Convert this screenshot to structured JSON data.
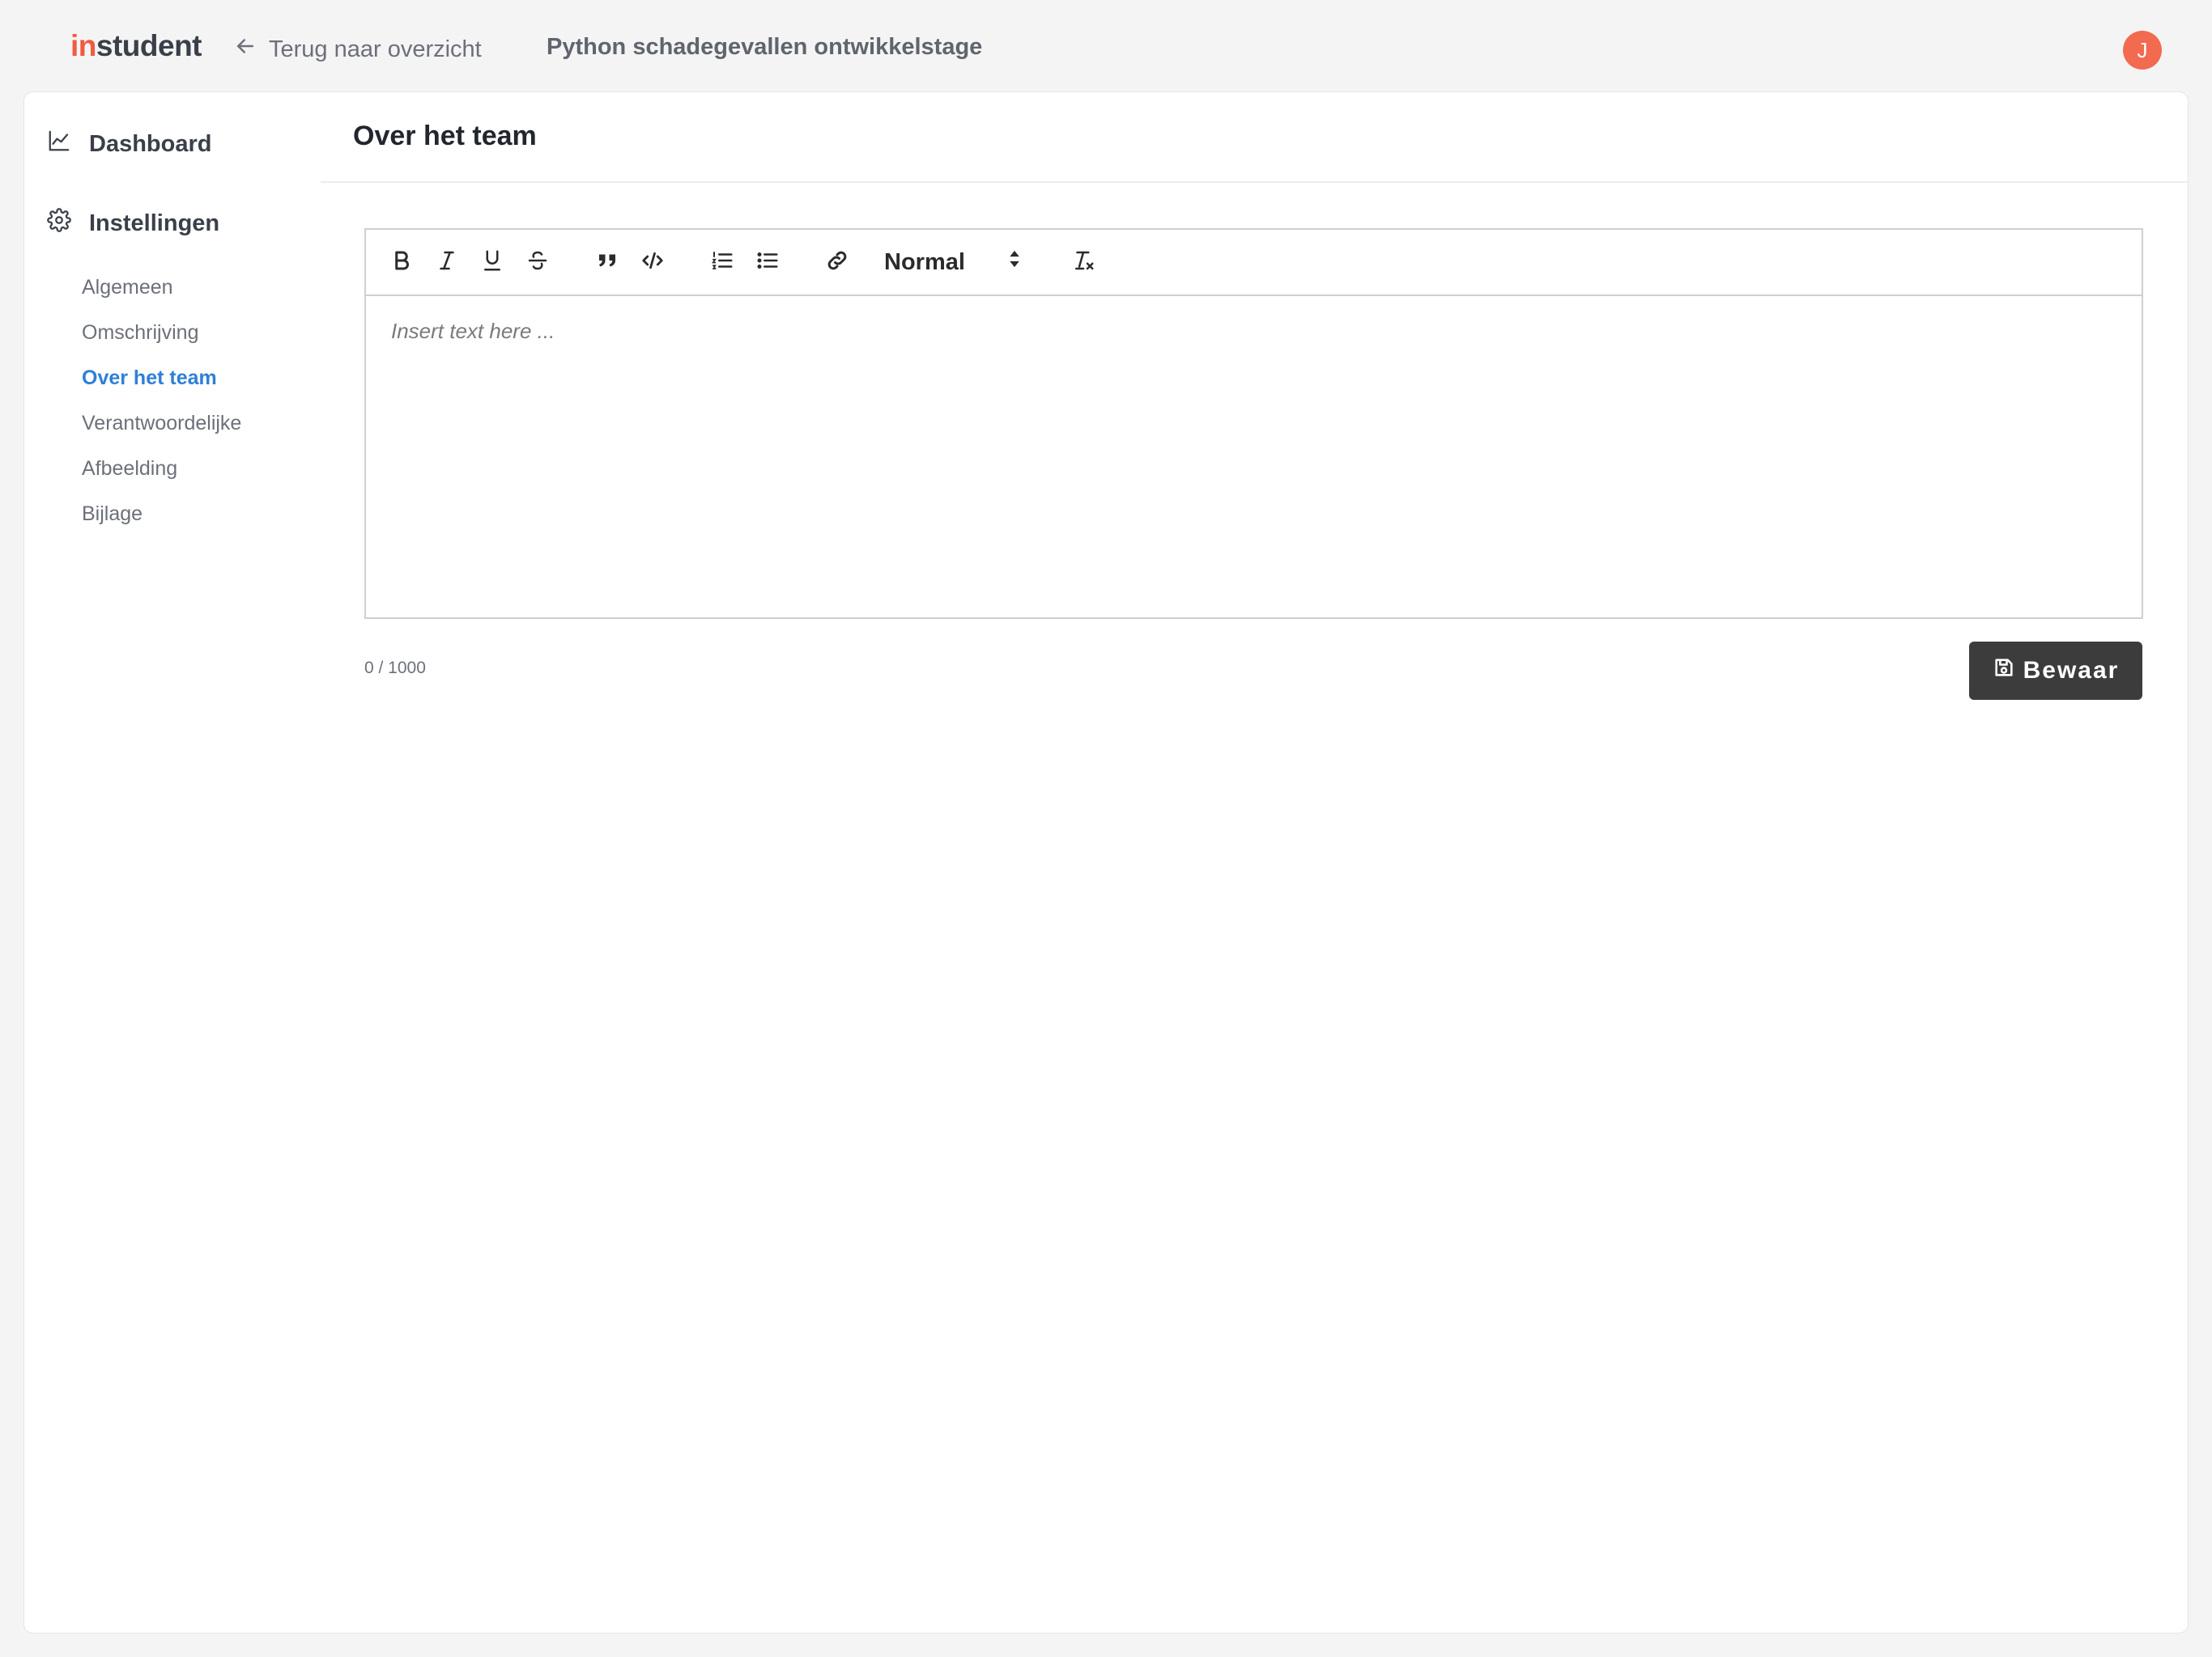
{
  "brand": {
    "prefix": "in",
    "suffix": "student",
    "accent_color": "#f15a40"
  },
  "topbar": {
    "back_label": "Terug naar overzicht",
    "project_title": "Python schadegevallen ontwikkelstage",
    "avatar_initial": "J",
    "avatar_color": "#f26a4f"
  },
  "sidebar": {
    "dashboard_label": "Dashboard",
    "settings_label": "Instellingen",
    "items": [
      {
        "label": "Algemeen",
        "active": false
      },
      {
        "label": "Omschrijving",
        "active": false
      },
      {
        "label": "Over het team",
        "active": true
      },
      {
        "label": "Verantwoordelijke",
        "active": false
      },
      {
        "label": "Afbeelding",
        "active": false
      },
      {
        "label": "Bijlage",
        "active": false
      }
    ],
    "active_color": "#2f7fd8"
  },
  "content": {
    "title": "Over het team",
    "editor": {
      "toolbar": [
        "bold",
        "italic",
        "underline",
        "strikethrough",
        "blockquote",
        "code-block",
        "ordered-list",
        "bullet-list",
        "link",
        "format-select",
        "clean-format"
      ],
      "format_value": "Normal",
      "placeholder": "Insert text here ..."
    },
    "char_count": "0 / 1000",
    "save_label": "Bewaar"
  }
}
